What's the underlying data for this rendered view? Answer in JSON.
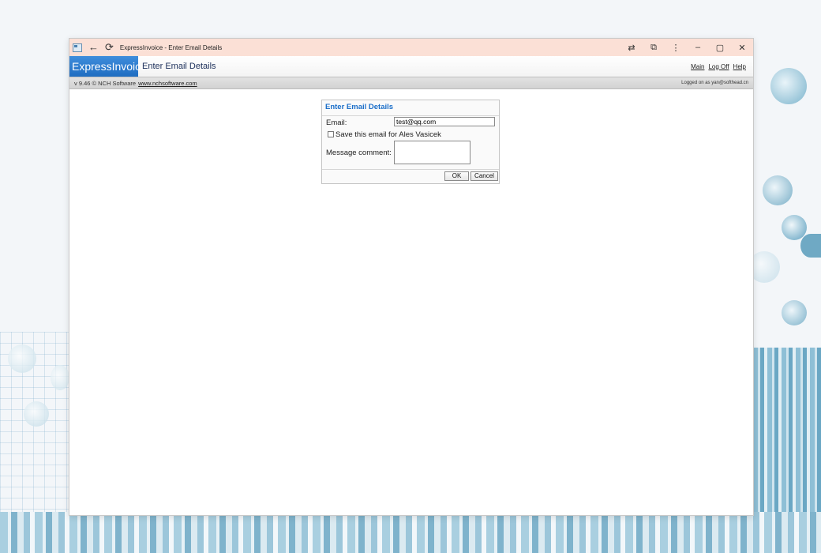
{
  "window": {
    "title": "ExpressInvoice - Enter Email Details",
    "controls": {
      "minimize": "–",
      "maximize": "▢",
      "close": "✕"
    }
  },
  "header": {
    "logo": "ExpressInvoice",
    "page_title": "Enter Email Details",
    "links": [
      "Main",
      "Log Off",
      "Help"
    ]
  },
  "statusbar": {
    "version": "v 9.46 © NCH Software",
    "website": "www.nchsoftware.com",
    "logged_on": "Logged on as yan@softhead.cn"
  },
  "dialog": {
    "title": "Enter Email Details",
    "email_label": "Email:",
    "email_value": "test@qq.com",
    "save_label": "Save this email for Ales Vasicek",
    "save_checked": false,
    "comment_label": "Message comment:",
    "comment_value": "",
    "ok_label": "OK",
    "cancel_label": "Cancel"
  }
}
